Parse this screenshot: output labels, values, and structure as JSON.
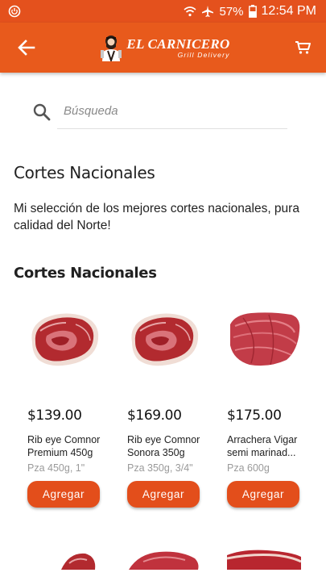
{
  "status_bar": {
    "battery": "57%",
    "time": "12:54 PM"
  },
  "app_bar": {
    "logo_title": "EL CARNICERO",
    "logo_subtitle": "Grill Delivery"
  },
  "search": {
    "placeholder": "Búsqueda"
  },
  "page": {
    "title": "Cortes Nacionales",
    "description": "Mi selección de los mejores cortes nacionales, pura calidad del Norte!",
    "section_title": "Cortes Nacionales"
  },
  "products": [
    {
      "price": "$139.00",
      "name": "Rib eye Comnor Premium 450g",
      "detail": "Pza 450g, 1\"",
      "button": "Agregar"
    },
    {
      "price": "$169.00",
      "name": "Rib eye Comnor Sonora 350g",
      "detail": "Pza 350g, 3/4\"",
      "button": "Agregar"
    },
    {
      "price": "$175.00",
      "name": "Arrachera Vigar semi marinad...",
      "detail": "Pza 600g",
      "button": "Agregar"
    }
  ],
  "colors": {
    "brand": "#e85a1c",
    "button": "#e34e1b"
  }
}
